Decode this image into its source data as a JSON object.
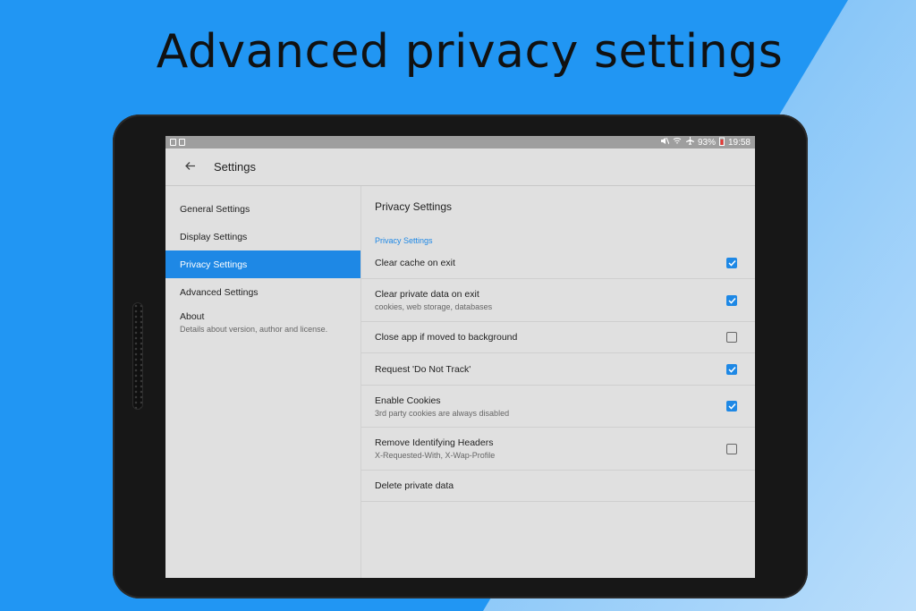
{
  "headline": "Advanced privacy settings",
  "statusbar": {
    "battery": "93%",
    "time": "19:58",
    "icons": [
      "mute-icon",
      "wifi-icon",
      "airplane-icon",
      "battery-icon"
    ]
  },
  "toolbar": {
    "title": "Settings",
    "back_icon": "arrow-left-icon"
  },
  "sidebar": {
    "items": [
      {
        "label": "General Settings"
      },
      {
        "label": "Display Settings"
      },
      {
        "label": "Privacy Settings"
      },
      {
        "label": "Advanced Settings"
      },
      {
        "label": "About",
        "sub": "Details about version, author and license."
      }
    ],
    "active_index": 2
  },
  "main": {
    "title": "Privacy Settings",
    "section": "Privacy Settings",
    "rows": [
      {
        "label": "Clear cache on exit",
        "checked": true
      },
      {
        "label": "Clear private data on exit",
        "sub": "cookies, web storage, databases",
        "checked": true
      },
      {
        "label": "Close app if moved to background",
        "checked": false
      },
      {
        "label": "Request 'Do Not Track'",
        "checked": true
      },
      {
        "label": "Enable Cookies",
        "sub": "3rd party cookies are always disabled",
        "checked": true
      },
      {
        "label": "Remove Identifying Headers",
        "sub": "X-Requested-With, X-Wap-Profile",
        "checked": false
      },
      {
        "label": "Delete private data"
      }
    ]
  },
  "colors": {
    "background": "#2196f3",
    "accent": "#1e88e5",
    "screen_bg": "#e0e0e0",
    "tablet_frame": "#171717"
  }
}
